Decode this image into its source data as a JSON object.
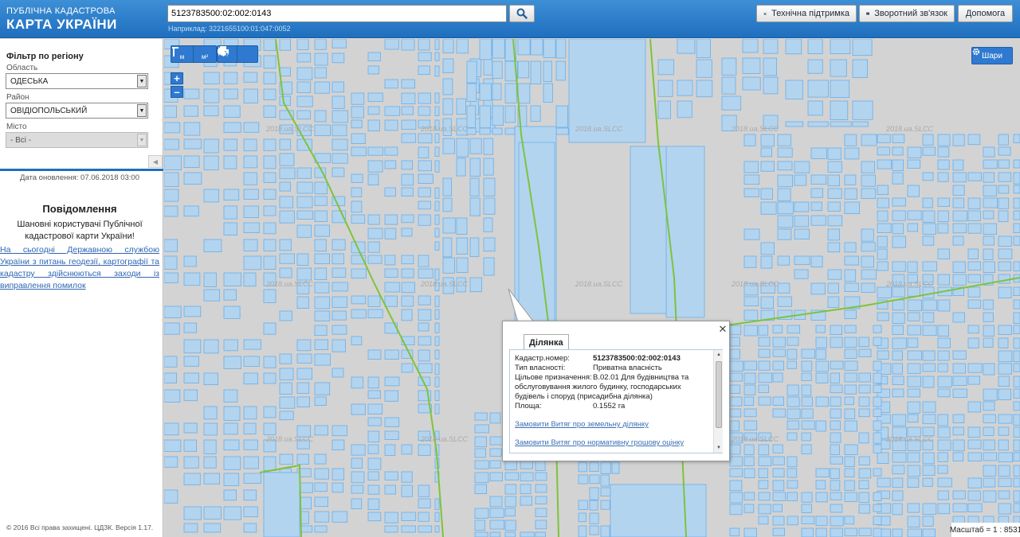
{
  "header": {
    "logo_line1": "ПУБЛІЧНА КАДАСТРОВА",
    "logo_line2": "КАРТА УКРАЇНИ",
    "search_value": "5123783500:02:002:0143",
    "search_example": "Наприклад: 3221655100:01:047:0052",
    "buttons": [
      "Технічна підтримка",
      "Зворотний зв'язок",
      "Допомога"
    ]
  },
  "sidebar": {
    "filter_title": "Фільтр по регіону",
    "oblast_label": "Область",
    "oblast_value": "ОДЕСЬКА",
    "raion_label": "Район",
    "raion_value": "ОВІДІОПОЛЬСЬКИЙ",
    "misto_label": "Місто",
    "misto_value": "- Всі -",
    "update_date": "Дата оновлення: 07.06.2018 03:00",
    "notice_title": "Повідомлення",
    "notice_text": "Шановні користувачі Публічної кадастрової карти України!",
    "notice_link": "На сьогодні Державною службою України з питань геодезії, картографії та кадастру здійснюються заходи із виправлення помилок",
    "copyright": "© 2016 Всі права захищені. ЦДЗК. Версія 1.17."
  },
  "map": {
    "tools": [
      "м",
      "м²"
    ],
    "zoom_in": "+",
    "zoom_out": "–",
    "layers_label": "Шари",
    "scale_label": "Масштаб = 1 : 8531",
    "watermark": "2018.ua.SLCC",
    "colors": {
      "parcel_fill": "#b3d4ef",
      "parcel_stroke": "#6aaee6",
      "road_line": "#7cc43a",
      "background": "#d3d3d3"
    }
  },
  "popup": {
    "tab": "Ділянка",
    "rows": [
      {
        "label": "Кадастр.номер:",
        "value": "5123783500:02:002:0143"
      },
      {
        "label": "Тип власності:",
        "value": "Приватна власність"
      },
      {
        "label": "Цільове призначення:",
        "value": "В.02.01 Для будівництва та обслуговування жилого будинку, господарських будівель і споруд (присадибна ділянка)"
      },
      {
        "label": "Площа:",
        "value": "0.1552 га"
      }
    ],
    "link1": "Замовити Витяг про земельну ділянку",
    "link2": "Замовити Витяг про нормативну грошову оцінку"
  }
}
